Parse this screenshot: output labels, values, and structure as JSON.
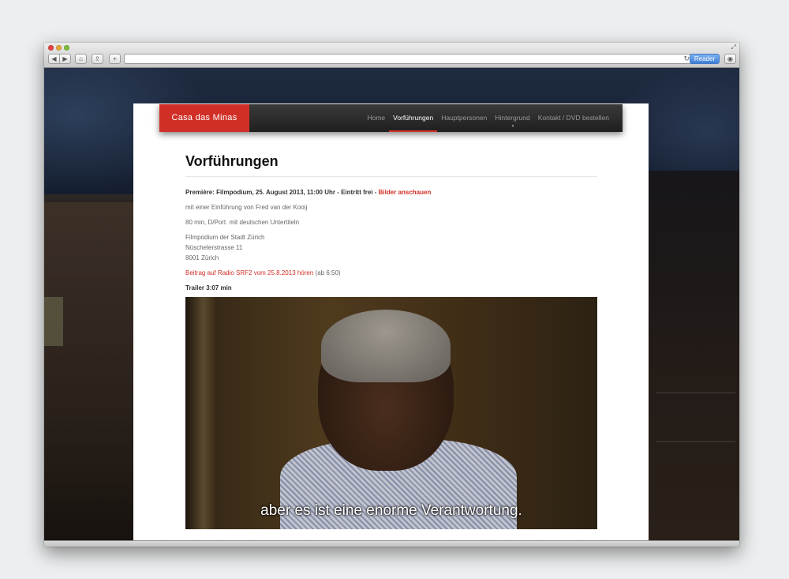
{
  "browser": {
    "reader_label": "Reader"
  },
  "site": {
    "brand": "Casa das Minas",
    "nav": [
      {
        "label": "Home"
      },
      {
        "label": "Vorführungen"
      },
      {
        "label": "Hauptpersonen"
      },
      {
        "label": "Hintergrund"
      },
      {
        "label": "Kontakt / DVD bestellen"
      }
    ],
    "active_nav_index": 1,
    "accent_color": "#d02f27"
  },
  "content": {
    "title": "Vorführungen",
    "premiere_text": "Première: Filmpodium, 25. August 2013, 11:00 Uhr - Eintritt frei - ",
    "premiere_link": "Bilder anschauen",
    "intro": "mit einer Einführung von Fred van der Kooij",
    "info": "80 min, D/Port. mit deutschen Untertiteln",
    "address": [
      "Filmpodium der Stadt Zürich",
      "Nüschelerstrasse 11",
      "8001 Zürich"
    ],
    "radio_link": "Beitrag auf Radio SRF2 vom 25.8.2013 hören",
    "radio_suffix": " (ab 6:50)",
    "trailer_label": "Trailer 3:07 min",
    "video_subtitle": "aber es ist eine enorme Verantwortung."
  }
}
